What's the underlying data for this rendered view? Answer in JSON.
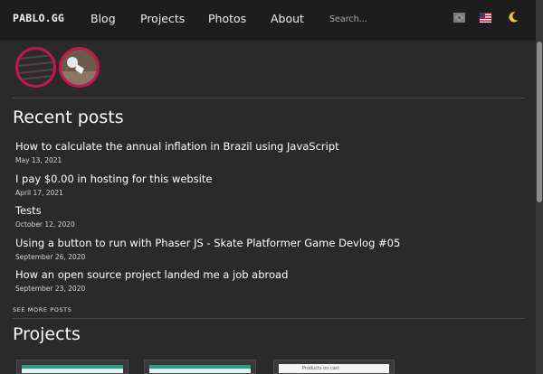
{
  "header": {
    "logo": "PABLO.GG",
    "nav": [
      {
        "label": "Blog"
      },
      {
        "label": "Projects"
      },
      {
        "label": "Photos"
      },
      {
        "label": "About"
      }
    ],
    "search": {
      "placeholder": "Search..."
    },
    "icons": [
      "brazil-flag-icon",
      "us-flag-icon",
      "moon-icon"
    ]
  },
  "recent": {
    "title": "Recent posts",
    "posts": [
      {
        "title": "How to calculate the annual inflation in Brazil using JavaScript",
        "date": "May 13, 2021"
      },
      {
        "title": "I pay $0.00 in hosting for this website",
        "date": "April 17, 2021"
      },
      {
        "title": "Tests",
        "date": "October 12, 2020"
      },
      {
        "title": "Using a button to run with Phaser JS - Skate Platformer Game Devlog #05",
        "date": "September 26, 2020"
      },
      {
        "title": "How an open source project landed me a job abroad",
        "date": "September 23, 2020"
      }
    ],
    "see_more": "SEE MORE POSTS"
  },
  "projects": {
    "title": "Projects",
    "card3_text": "Products on cart"
  },
  "colors": {
    "accent": "#c8154f",
    "header_bg": "#1e1d1e",
    "page_bg": "#2b2a2b"
  }
}
